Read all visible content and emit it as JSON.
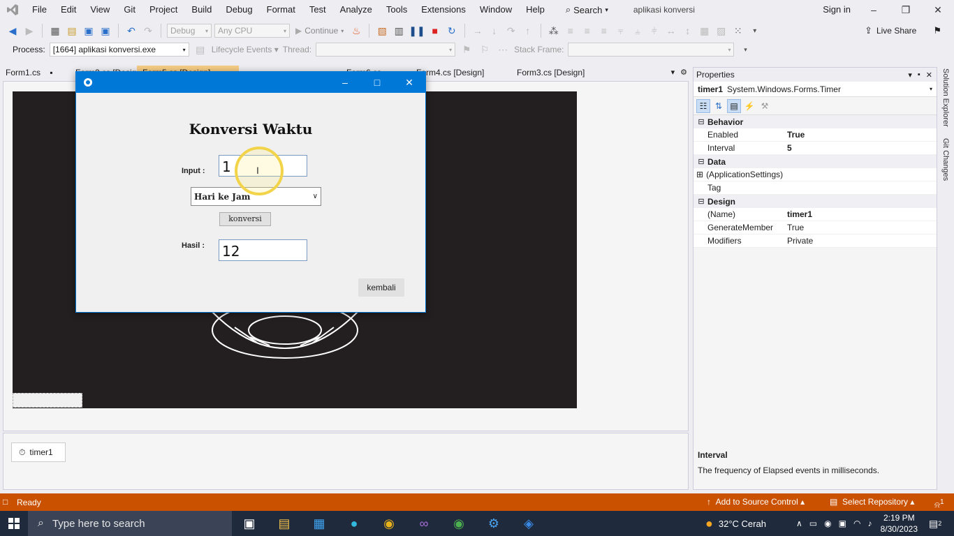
{
  "menubar": {
    "items": [
      "File",
      "Edit",
      "View",
      "Git",
      "Project",
      "Build",
      "Debug",
      "Format",
      "Test",
      "Analyze",
      "Tools",
      "Extensions",
      "Window",
      "Help"
    ],
    "search_label": "Search",
    "solution_name": "aplikasi konversi",
    "signin": "Sign in"
  },
  "toolbar": {
    "config": "Debug",
    "platform": "Any CPU",
    "continue_label": "Continue",
    "live_share": "Live Share"
  },
  "debugbar": {
    "process_label": "Process:",
    "process_value": "[1664] aplikasi konversi.exe",
    "lifecycle_label": "Lifecycle Events",
    "thread_label": "Thread:",
    "stack_label": "Stack Frame:"
  },
  "tabs": [
    "Form1.cs",
    "Form2.cs [Design]",
    "Form5.cs [Design]",
    "Form6.cs",
    "Form4.cs [Design]",
    "Form3.cs [Design]"
  ],
  "app": {
    "title": "Konversi Waktu",
    "input_label": "Input :",
    "input_value": "1",
    "combo_value": "Hari ke Jam",
    "convert_button": "konversi",
    "result_label": "Hasil :",
    "result_value": "12",
    "back_button": "kembali"
  },
  "component_tray": {
    "timer_label": "timer1"
  },
  "properties": {
    "header": "Properties",
    "object_name": "timer1",
    "object_type": "System.Windows.Forms.Timer",
    "categories": [
      {
        "name": "Behavior",
        "rows": [
          {
            "name": "Enabled",
            "value": "True"
          },
          {
            "name": "Interval",
            "value": "5"
          }
        ]
      },
      {
        "name": "Data",
        "rows": [
          {
            "name": "(ApplicationSettings)",
            "value": ""
          },
          {
            "name": "Tag",
            "value": ""
          }
        ]
      },
      {
        "name": "Design",
        "rows": [
          {
            "name": "(Name)",
            "value": "timer1"
          },
          {
            "name": "GenerateMember",
            "value": "True"
          },
          {
            "name": "Modifiers",
            "value": "Private"
          }
        ]
      }
    ],
    "desc_title": "Interval",
    "desc_text": "The frequency of Elapsed events in milliseconds."
  },
  "side_tabs": [
    "Solution Explorer",
    "Git Changes"
  ],
  "status": {
    "ready": "Ready",
    "add_source": "Add to Source Control",
    "select_repo": "Select Repository",
    "notifications": "1"
  },
  "taskbar": {
    "search_placeholder": "Type here to search",
    "weather": "32°C  Cerah",
    "time": "2:19 PM",
    "date": "8/30/2023",
    "notif_count": "2"
  },
  "colors": {
    "accent": "#0078d7",
    "status": "#ca5100",
    "vs_purple": "#68217a",
    "cursor_ring": "#f2d44b"
  }
}
